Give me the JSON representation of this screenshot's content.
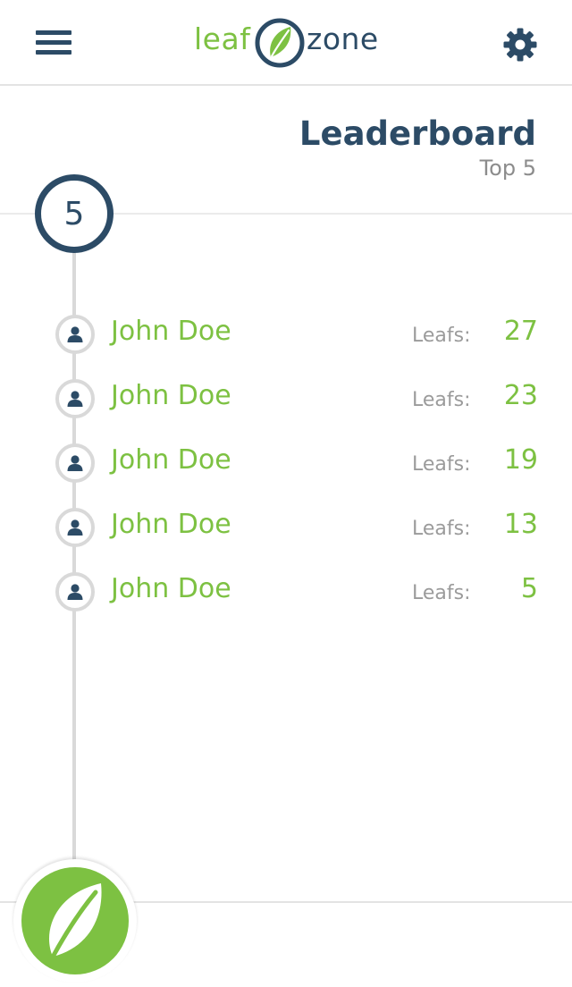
{
  "header": {
    "logo_left": "leaf",
    "logo_right": "zone",
    "menu_icon": "menu-icon",
    "settings_icon": "gear-icon"
  },
  "page": {
    "title": "Leaderboard",
    "subtitle": "Top 5",
    "count": "5"
  },
  "leaders": [
    {
      "name": "John Doe",
      "score_label": "Leafs:",
      "score": "27"
    },
    {
      "name": "John Doe",
      "score_label": "Leafs:",
      "score": "23"
    },
    {
      "name": "John Doe",
      "score_label": "Leafs:",
      "score": "19"
    },
    {
      "name": "John Doe",
      "score_label": "Leafs:",
      "score": "13"
    },
    {
      "name": "John Doe",
      "score_label": "Leafs:",
      "score": "5"
    }
  ],
  "fab": {
    "icon": "leaf-icon"
  },
  "colors": {
    "brand_green": "#7dc142",
    "brand_navy": "#2c4b66",
    "muted_gray": "#9b9b9b",
    "line_gray": "#d9d9d9"
  }
}
